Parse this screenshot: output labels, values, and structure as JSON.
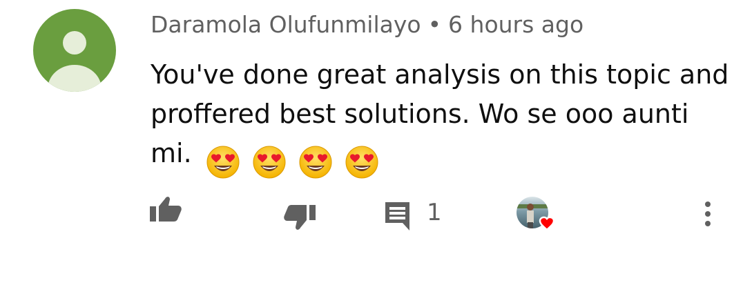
{
  "comment": {
    "author": "Daramola Olufunmilayo",
    "separator": "•",
    "time": "6 hours ago",
    "text": "You've done great analysis on this topic and proffered best solutions. Wo se ooo aunti mi.",
    "emoji_icons": [
      "heart-eyes-emoji",
      "heart-eyes-emoji",
      "heart-eyes-emoji",
      "heart-eyes-emoji"
    ]
  },
  "actions": {
    "reply_count": "1",
    "icons": [
      "thumbs-up-icon",
      "thumbs-down-icon",
      "reply-icon",
      "creator-heart-icon",
      "more-options-icon"
    ]
  },
  "colors": {
    "avatar_bg": "#6a9e3f",
    "avatar_figure": "#e6eed9",
    "meta_text": "#606060",
    "body_text": "#0f0f0f",
    "icon": "#606060",
    "heart": "#ff0000"
  }
}
